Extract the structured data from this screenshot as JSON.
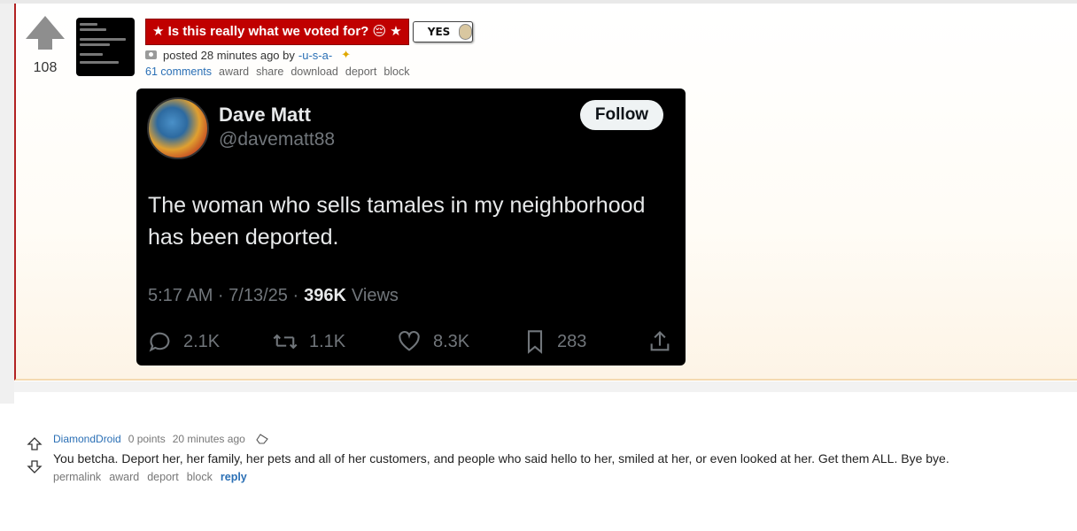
{
  "post": {
    "score": "108",
    "title": "★ Is this really what we voted for? 😔 ★",
    "flair": "YES",
    "tagline_prefix": "posted 28 minutes ago by",
    "author": "-u-s-a-",
    "actions": {
      "comments": "61 comments",
      "award": "award",
      "share": "share",
      "download": "download",
      "deport": "deport",
      "block": "block"
    }
  },
  "tweet": {
    "name": "Dave Matt",
    "handle": "@davematt88",
    "follow": "Follow",
    "body_line1": "The woman who sells tamales in my neighborhood",
    "body_line2": "has been deported.",
    "time": "5:17 AM · 7/13/25 ·",
    "views_num": "396K",
    "views_label": "Views",
    "replies": "2.1K",
    "reposts": "1.1K",
    "likes": "8.3K",
    "bookmarks": "283"
  },
  "comment": {
    "user": "DiamondDroid",
    "points": "0 points",
    "time": "20 minutes ago",
    "body": "You betcha. Deport her, her family, her pets and all of her customers, and people who said hello to her, smiled at her, or even looked at her. Get them ALL. Bye bye.",
    "actions": {
      "permalink": "permalink",
      "award": "award",
      "deport": "deport",
      "block": "block",
      "reply": "reply"
    }
  },
  "colors": {
    "title_bg": "#c00000",
    "link": "#2a6fb5",
    "tweet_bg": "#000000"
  },
  "icons": [
    "upvote-arrow-icon",
    "camera-icon",
    "award-icon",
    "reply-icon",
    "repost-icon",
    "like-icon",
    "bookmark-icon",
    "share-icon",
    "downvote-icon",
    "eraser-icon"
  ]
}
